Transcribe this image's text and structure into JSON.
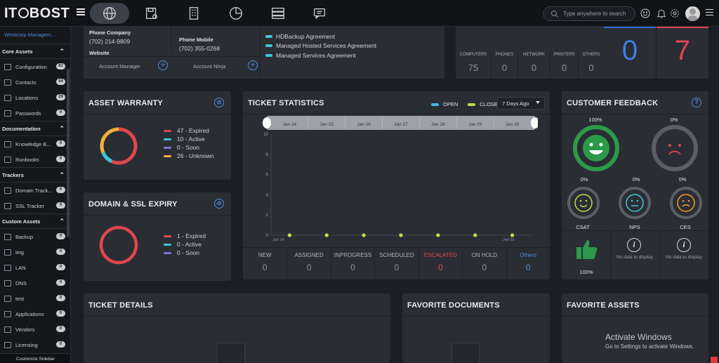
{
  "app": {
    "brand_left": "IT",
    "brand_right": "BOST"
  },
  "topbar": {
    "search_placeholder": "Type anywhere to search"
  },
  "sidebar": {
    "account": "Westcorp Managem...",
    "sections": [
      {
        "title": "Core Assets",
        "items": [
          {
            "label": "Configuration",
            "count": "83"
          },
          {
            "label": "Contacts",
            "count": "44"
          },
          {
            "label": "Locations",
            "count": "29"
          },
          {
            "label": "Passwords",
            "count": "0"
          }
        ]
      },
      {
        "title": "Documentation",
        "items": [
          {
            "label": "Knowledge B...",
            "count": "0"
          },
          {
            "label": "Runbooks",
            "count": "0"
          }
        ]
      },
      {
        "title": "Trackers",
        "items": [
          {
            "label": "Domain Track...",
            "count": "0"
          },
          {
            "label": "SSL Tracker",
            "count": "0"
          }
        ]
      },
      {
        "title": "Custom Assets",
        "items": [
          {
            "label": "Backup",
            "count": "0"
          },
          {
            "label": "img",
            "count": "0"
          },
          {
            "label": "LAN",
            "count": "0"
          },
          {
            "label": "DNS",
            "count": "0"
          },
          {
            "label": "test",
            "count": "0"
          },
          {
            "label": "Applications",
            "count": "0"
          },
          {
            "label": "Vendors",
            "count": "0"
          },
          {
            "label": "Licensing",
            "count": "0"
          }
        ]
      }
    ],
    "customize": "Customize Sidebar"
  },
  "company": {
    "phone_company_label": "Phone Company",
    "phone_company": "(702) 214-9809",
    "phone_mobile_label": "Phone Mobile",
    "phone_mobile": "(702) 355-0268",
    "website_label": "Website",
    "account_manager": "Account Manager",
    "account_ninja": "Account Ninja",
    "agreements": [
      "HDBackup Agreement",
      "Managed Hosted Services Agreement",
      "Managed Services Agreement"
    ]
  },
  "assets_summary": {
    "cols": [
      {
        "label": "COMPUTERS",
        "value": "75"
      },
      {
        "label": "PHONES",
        "value": "0"
      },
      {
        "label": "NETWORK",
        "value": "0"
      },
      {
        "label": "PRINTERS",
        "value": "0"
      },
      {
        "label": "OTHERS",
        "value": "0"
      }
    ],
    "blue_value": "0",
    "red_value": "7"
  },
  "warranty": {
    "title": "ASSET WARRANTY",
    "legend": [
      {
        "text": "47 - Expired",
        "color": "#e0464e",
        "value": 47
      },
      {
        "text": "10 - Active",
        "color": "#3ec7d8",
        "value": 10
      },
      {
        "text": "0 - Soon",
        "color": "#8a6fd1",
        "value": 0
      },
      {
        "text": "26 - Unknown",
        "color": "#f0b03c",
        "value": 26
      }
    ]
  },
  "domain": {
    "title": "DOMAIN & SSL EXPIRY",
    "legend": [
      {
        "text": "1 - Expired",
        "color": "#e0464e"
      },
      {
        "text": "0 - Active",
        "color": "#3ec7d8"
      },
      {
        "text": "0 - Soon",
        "color": "#8a6fd1"
      }
    ]
  },
  "tickets": {
    "title": "TICKET STATISTICS",
    "open_label": "OPEN",
    "close_label": "CLOSE",
    "range": "7 Days Ago",
    "open_color": "#3fb8e8",
    "close_color": "#b9e04a",
    "stats": [
      {
        "label": "NEW",
        "value": "0"
      },
      {
        "label": "ASSIGNED",
        "value": "0"
      },
      {
        "label": "INPROGRESS",
        "value": "0"
      },
      {
        "label": "SCHEDULED",
        "value": "0"
      },
      {
        "label": "ESCALATED",
        "value": "0"
      },
      {
        "label": "ON HOLD",
        "value": "0"
      },
      {
        "label": "Others",
        "value": "0"
      }
    ]
  },
  "chart_data": {
    "type": "line",
    "categories": [
      "Jan 24",
      "Jan 25",
      "Jan 26",
      "Jan 27",
      "Jan 28",
      "Jan 29",
      "Jan 30"
    ],
    "series": [
      {
        "name": "OPEN",
        "values": [
          0,
          0,
          0,
          0,
          0,
          0,
          0
        ]
      },
      {
        "name": "CLOSE",
        "values": [
          0,
          0,
          0,
          0,
          0,
          0,
          0
        ]
      }
    ],
    "yticks": [
      "10",
      "8",
      "6",
      "4",
      "2",
      "0"
    ],
    "ylim": [
      0,
      10
    ],
    "axis_labels_bottom": [
      "Jan 24",
      "Jan 30"
    ]
  },
  "feedback": {
    "title": "CUSTOMER FEEDBACK",
    "happy_pct": "100%",
    "sad_pct": "0%",
    "csat_pct": "0%",
    "nps_pct": "0%",
    "ces_pct": "0%",
    "csat": "CSAT",
    "nps": "NPS",
    "ces": "CES",
    "thumb_pct": "100%",
    "nodata1": "No data to display",
    "nodata2": "No data to display"
  },
  "bottom": {
    "ticket_details": "TICKET DETAILS",
    "favorite_documents": "FAVORITE DOCUMENTS",
    "favorite_assets": "FAVORITE ASSETS"
  },
  "watermark": {
    "title": "Activate Windows",
    "sub": "Go to Settings to activate Windows."
  }
}
